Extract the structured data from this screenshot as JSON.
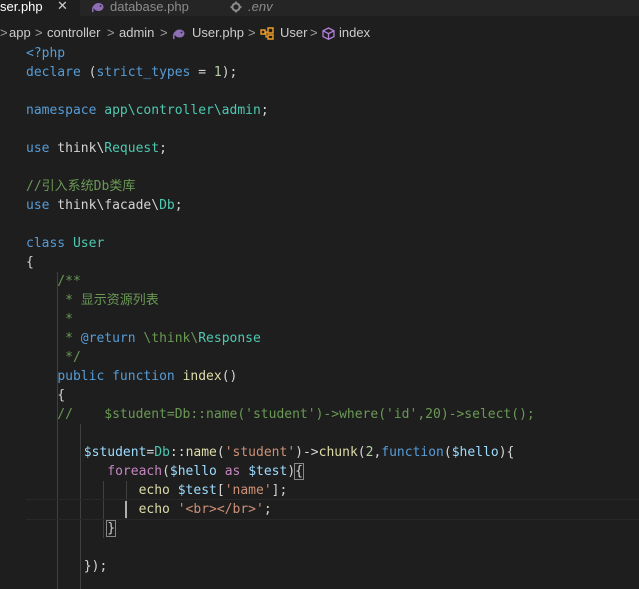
{
  "tabs": [
    {
      "label": "ser.php",
      "close": "✕",
      "active": true
    },
    {
      "label": "database.php",
      "active": false
    },
    {
      "label": ".env",
      "active": false
    }
  ],
  "breadcrumb": {
    "items": [
      "app",
      "controller",
      "admin",
      "User.php",
      "User",
      "index"
    ],
    "separator": ">"
  },
  "icons": {
    "php_file": "elephant-icon",
    "settings_file": "gear-icon",
    "class_symbol": "class-icon",
    "method_symbol": "cube-icon"
  },
  "code": {
    "lines": [
      "<?php",
      "declare (strict_types = 1);",
      "",
      "namespace app\\controller\\admin;",
      "",
      "use think\\Request;",
      "",
      "//引入系统Db类库",
      "use think\\facade\\Db;",
      "",
      "class User",
      "{",
      "    /**",
      "     * 显示资源列表",
      "     *",
      "     * @return \\think\\Response",
      "     */",
      "    public function index()",
      "    {",
      "    //    $student=Db::name('student')->where('id',20)->select();",
      "",
      "       $student=Db::name('student')->chunk(2,function($hello){",
      "          foreach($hello as $test){",
      "              echo $test['name'];",
      "              echo '<br></br>';",
      "          }",
      "",
      "       });"
    ]
  },
  "colors": {
    "background": "#1e1e1e",
    "keyword": "#569cd6",
    "control": "#c586c0",
    "type": "#4ec9b0",
    "function": "#dcdcaa",
    "variable": "#9cdcfe",
    "string": "#ce9178",
    "number": "#b5cea8",
    "comment": "#6a9955",
    "text": "#d4d4d4"
  }
}
